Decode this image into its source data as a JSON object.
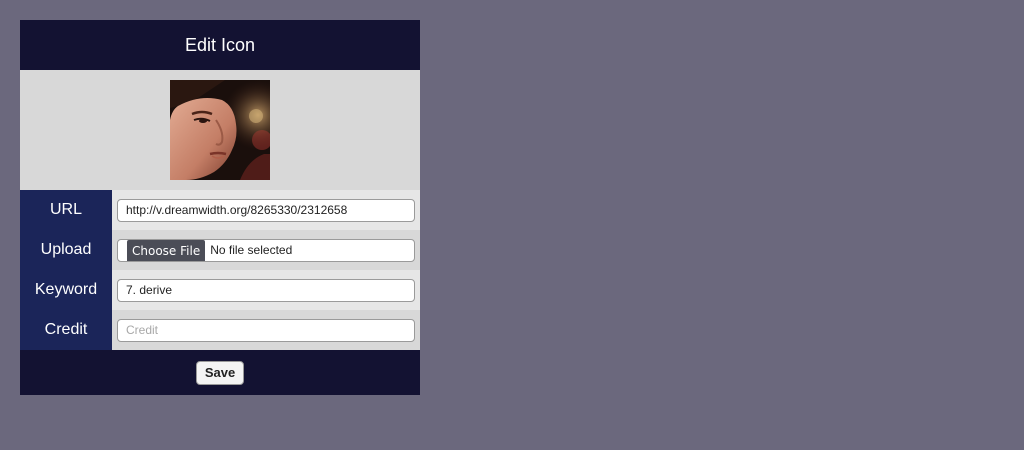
{
  "dialog": {
    "title": "Edit Icon"
  },
  "preview": {
    "alt": "icon preview"
  },
  "form": {
    "url": {
      "label": "URL",
      "value": "http://v.dreamwidth.org/8265330/2312658"
    },
    "upload": {
      "label": "Upload",
      "button_label": "Choose File",
      "status": "No file selected"
    },
    "keyword": {
      "label": "Keyword",
      "value": "7. derive"
    },
    "credit": {
      "label": "Credit",
      "value": "",
      "placeholder": "Credit"
    }
  },
  "footer": {
    "save_label": "Save"
  },
  "colors": {
    "page_background": "#6b687d",
    "header_background": "#131232",
    "label_background": "#1b2559",
    "panel_background": "#d8d8d8"
  }
}
